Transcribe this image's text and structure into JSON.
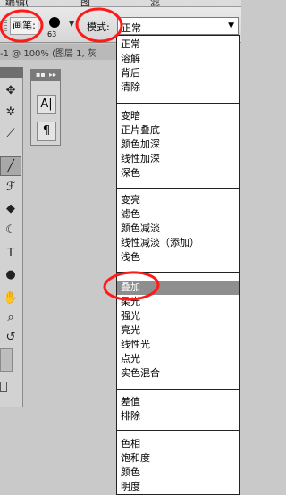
{
  "menubar": {
    "items": [
      "编辑(",
      "图",
      "滤"
    ]
  },
  "options_bar": {
    "tool_preset_label": "画笔:",
    "brush_size": "63",
    "mode_label": "模式:",
    "mode_value": "正常"
  },
  "document": {
    "title_fragment": "-1 @ 100% (图层 1, 灰"
  },
  "toolbox": {
    "tools": [
      {
        "name": "move-tool",
        "glyph": "✥"
      },
      {
        "name": "magic-wand-tool",
        "glyph": "✲"
      },
      {
        "name": "eyedropper-tool",
        "glyph": "⟋"
      },
      {
        "name": "brush-tool",
        "glyph": "╱"
      },
      {
        "name": "history-brush-tool",
        "glyph": "ℱ"
      },
      {
        "name": "paint-bucket-tool",
        "glyph": "◆"
      },
      {
        "name": "dodge-tool",
        "glyph": "☾"
      },
      {
        "name": "type-tool",
        "glyph": "T"
      },
      {
        "name": "ellipse-tool",
        "glyph": "●"
      },
      {
        "name": "hand-tool",
        "glyph": "✋"
      },
      {
        "name": "zoom-tool",
        "glyph": "⌕"
      },
      {
        "name": "swap-colors-tool",
        "glyph": "↺"
      }
    ]
  },
  "palette": {
    "head_dots": "▪▪",
    "head_more": "▸▸",
    "buttons": [
      "A|",
      "¶"
    ]
  },
  "dropdown": {
    "groups": [
      [
        "正常",
        "溶解",
        "背后",
        "清除"
      ],
      [
        "变暗",
        "正片叠底",
        "颜色加深",
        "线性加深",
        "深色"
      ],
      [
        "变亮",
        "滤色",
        "颜色减淡",
        "线性减淡（添加）",
        "浅色"
      ],
      [
        "叠加",
        "柔光",
        "强光",
        "亮光",
        "线性光",
        "点光",
        "实色混合"
      ],
      [
        "差值",
        "排除"
      ],
      [
        "色相",
        "饱和度",
        "颜色",
        "明度"
      ]
    ],
    "highlighted": "叠加"
  },
  "colors": {
    "annotation": "#ff1a1a",
    "highlight": "#8e8e8e"
  }
}
